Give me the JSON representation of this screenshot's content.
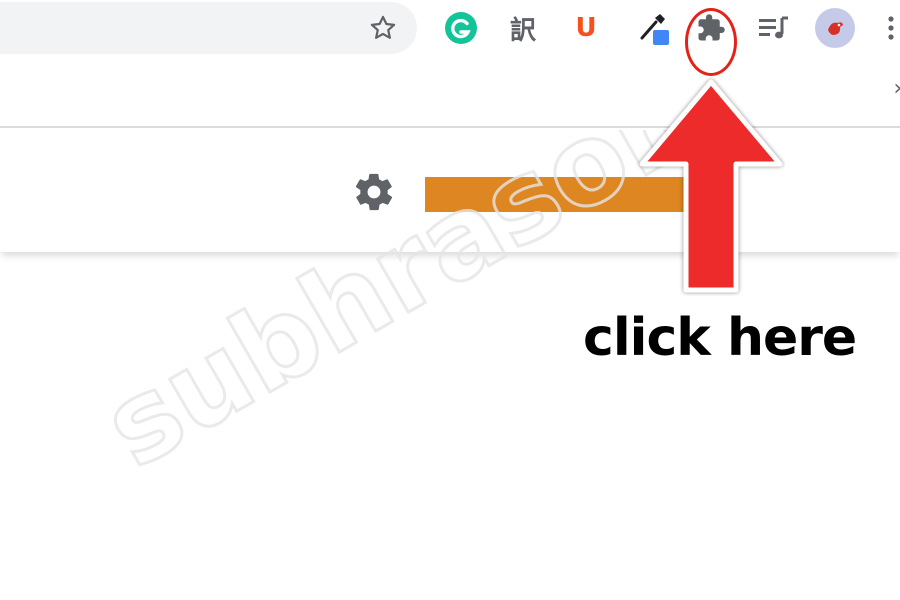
{
  "toolbar": {
    "bookmark_icon": "star-outline-icon",
    "extensions": [
      {
        "name": "grammarly",
        "icon": "grammarly-g-icon",
        "color": "#15c39a",
        "glyph": "G"
      },
      {
        "name": "translate-extension",
        "icon": "kanji-translate-icon",
        "color": "#5f6368",
        "glyph": "訳"
      },
      {
        "name": "ublock-u",
        "icon": "u-letter-icon",
        "color": "#f4511e",
        "glyph": "U"
      },
      {
        "name": "color-picker",
        "icon": "eyedropper-icon",
        "color": "#4285f4"
      },
      {
        "name": "extensions-menu",
        "icon": "puzzle-piece-icon",
        "color": "#5f6368"
      },
      {
        "name": "reading-list",
        "icon": "media-queue-icon",
        "color": "#5f6368"
      },
      {
        "name": "profile",
        "icon": "profile-avatar-icon",
        "color": "#c5cae9"
      }
    ],
    "menu_icon": "kebab-menu-icon"
  },
  "bookmarks_bar": {
    "overflow_label": "»"
  },
  "page": {
    "settings_icon": "gear-icon",
    "hidden_glyph": "⁄"
  },
  "annotation": {
    "callout": "click here",
    "arrow_color": "#ee2b2b",
    "ring_color": "#e2231a"
  },
  "colors": {
    "redaction": "#dd8622",
    "omnibox_bg": "#f1f3f4",
    "icon_gray": "#5f6368"
  },
  "watermark": {
    "text": "subhrasom.com"
  }
}
